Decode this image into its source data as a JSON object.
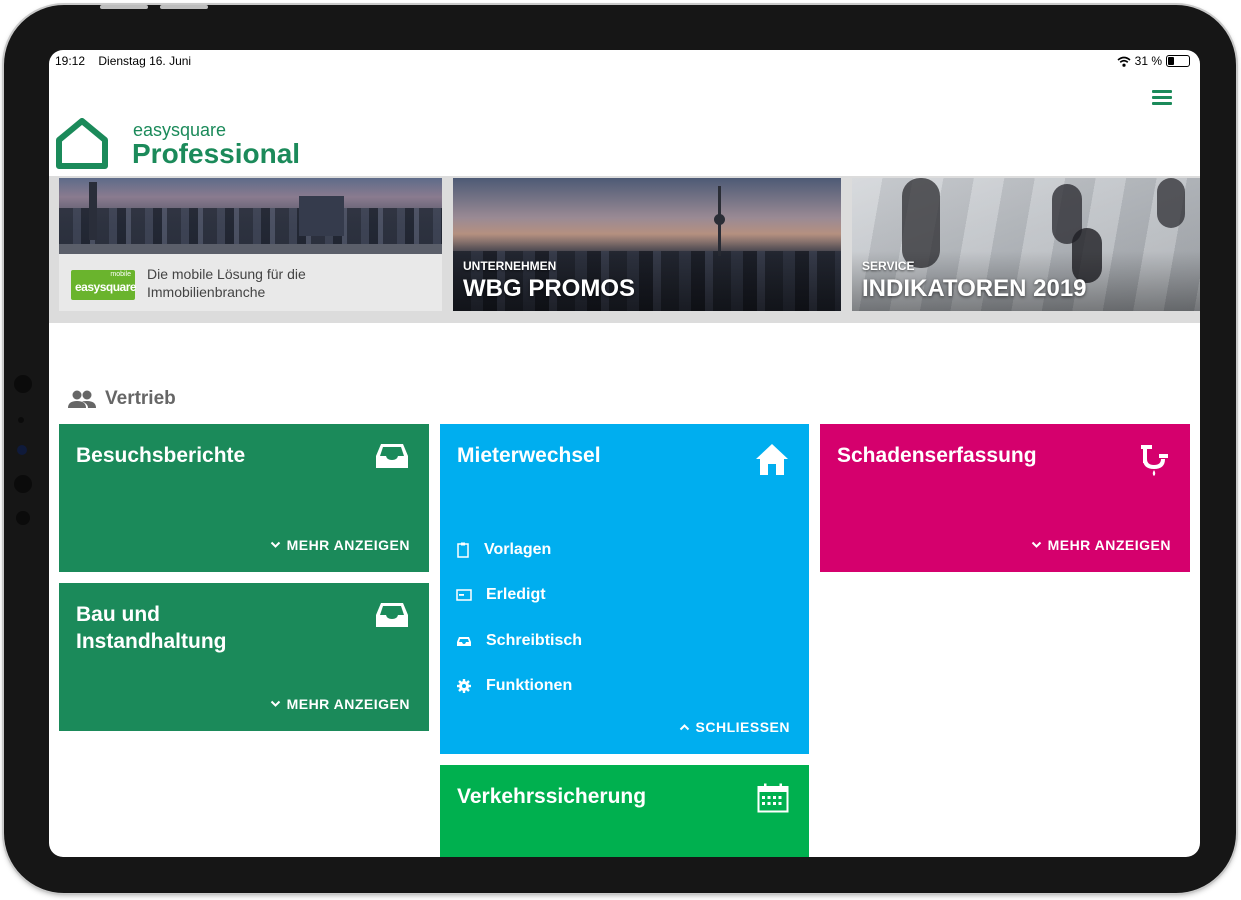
{
  "status_bar": {
    "time": "19:12",
    "date": "Dienstag 16. Juni",
    "battery": "31 %"
  },
  "logo": {
    "small": "easysquare",
    "big": "Professional"
  },
  "banners": [
    {
      "line1": "Die mobile Lösung für die",
      "line2": "Immobilienbranche",
      "badge_top": "mobile",
      "badge_main": "easysquare"
    },
    {
      "category": "UNTERNEHMEN",
      "title": "WBG PROMOS"
    },
    {
      "category": "SERVICE",
      "title": "INDIKATOREN 2019"
    }
  ],
  "section": {
    "title": "Vertrieb"
  },
  "tiles": [
    {
      "title": "Besuchsberichte",
      "more": "MEHR ANZEIGEN",
      "color": "#1b8a5a"
    },
    {
      "title": "Bau und Instandhaltung",
      "more": "MEHR ANZEIGEN",
      "color": "#1b8a5a"
    },
    {
      "title": "Mieterwechsel",
      "close": "SCHLIESSEN",
      "color": "#00aeef",
      "items": [
        "Vorlagen",
        "Erledigt",
        "Schreibtisch",
        "Funktionen"
      ]
    },
    {
      "title": "Verkehrssicherung",
      "color": "#00b04f"
    },
    {
      "title": "Schadenserfassung",
      "more": "MEHR ANZEIGEN",
      "color": "#d5006d"
    }
  ]
}
